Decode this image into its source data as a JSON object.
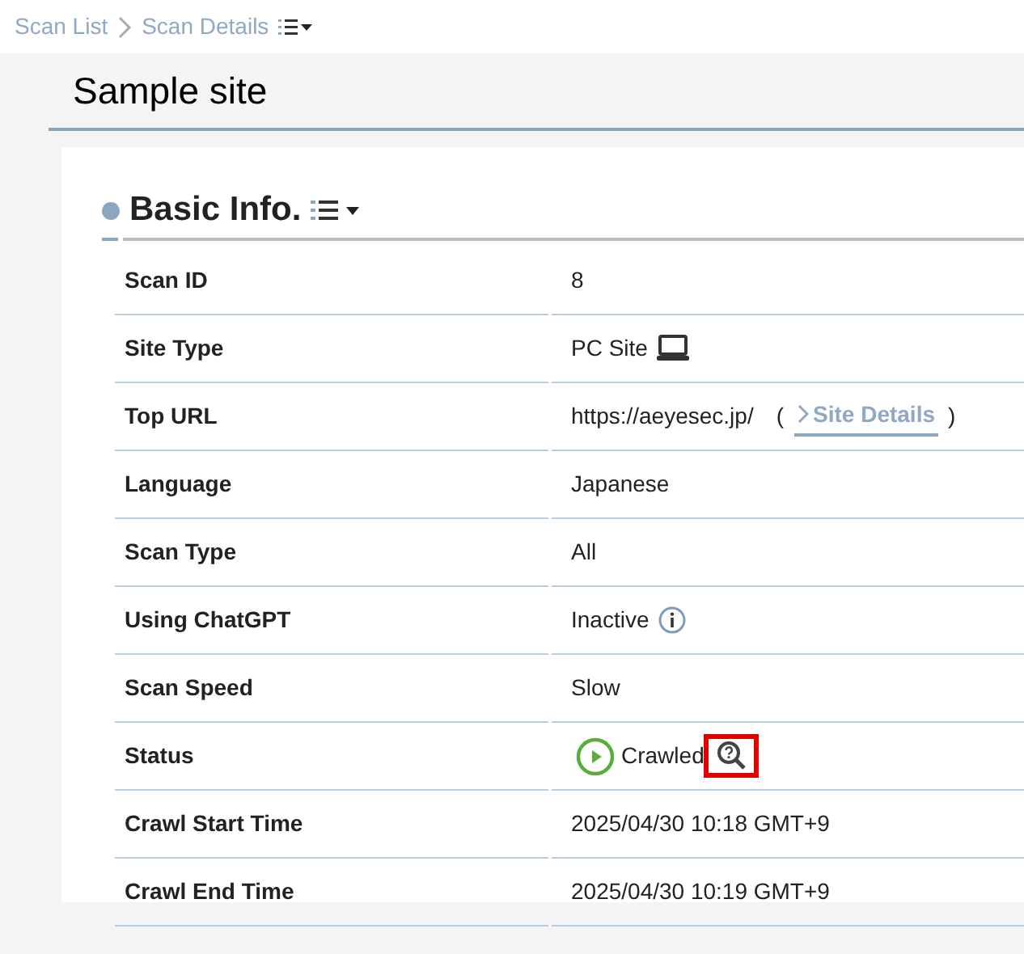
{
  "breadcrumb": [
    {
      "label": "Scan List"
    },
    {
      "label": "Scan Details"
    }
  ],
  "page_title": "Sample site",
  "section": {
    "title": "Basic Info.",
    "rows": [
      {
        "label": "Scan ID",
        "kind": "text",
        "value": "8"
      },
      {
        "label": "Site Type",
        "kind": "device",
        "value": "PC Site"
      },
      {
        "label": "Top URL",
        "kind": "url",
        "value": "https://aeyesec.jp/",
        "link_open": "(",
        "link": "Site Details",
        "link_close": ")"
      },
      {
        "label": "Language",
        "kind": "text",
        "value": "Japanese"
      },
      {
        "label": "Scan Type",
        "kind": "text",
        "value": "All"
      },
      {
        "label": "Using ChatGPT",
        "kind": "info",
        "value": "Inactive"
      },
      {
        "label": "Scan Speed",
        "kind": "text",
        "value": "Slow"
      },
      {
        "label": "Status",
        "kind": "status",
        "value": "Crawled",
        "highlighted": true
      },
      {
        "label": "Crawl Start Time",
        "kind": "text",
        "value": "2025/04/30 10:18 GMT+9"
      },
      {
        "label": "Crawl End Time",
        "kind": "text",
        "value": "2025/04/30 10:19 GMT+9"
      }
    ]
  }
}
